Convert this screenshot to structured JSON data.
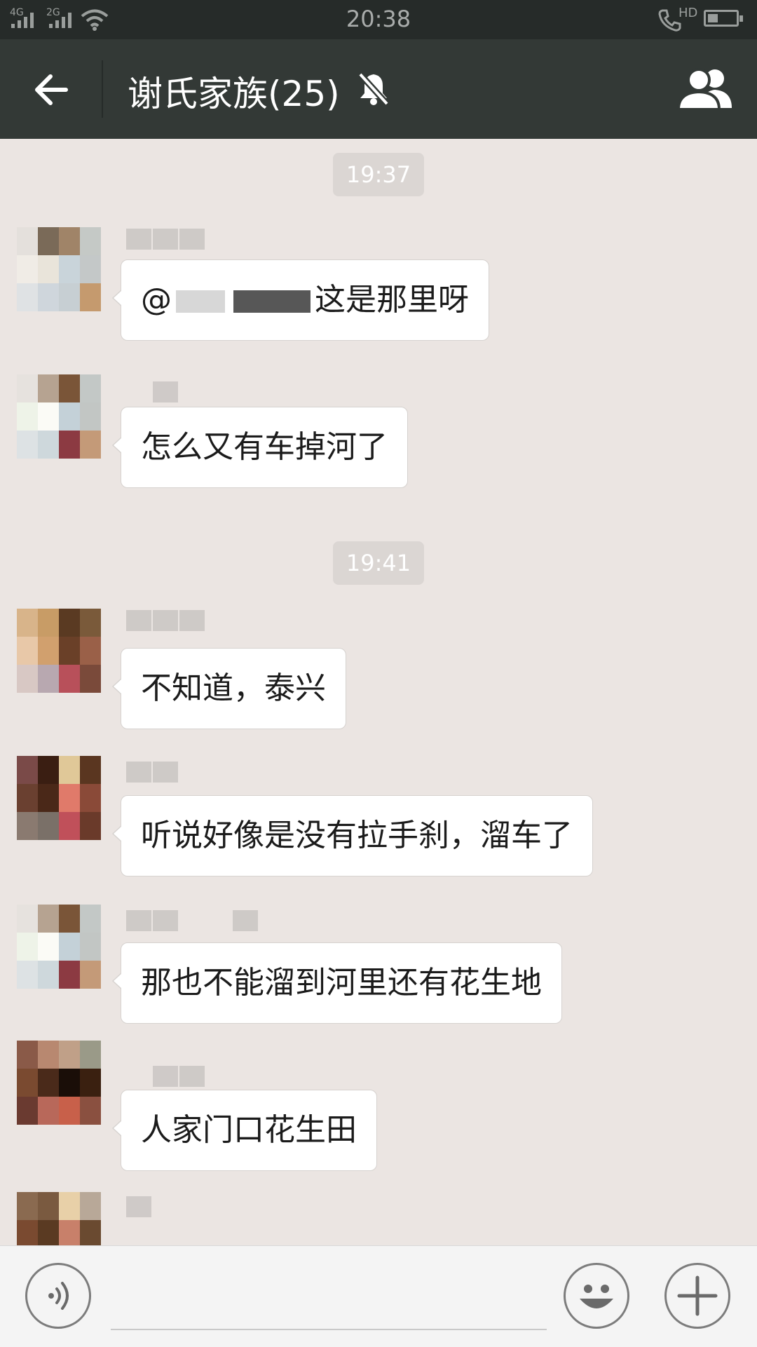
{
  "status_bar": {
    "time": "20:38",
    "network_1": "4G",
    "network_2": "2G",
    "hd_label": "HD",
    "icons": [
      "signal-icon",
      "signal-icon",
      "wifi-icon",
      "hd-call-icon",
      "battery-icon"
    ]
  },
  "header": {
    "back_icon": "back-arrow-icon",
    "title": "谢氏家族(25)",
    "mute_icon": "bell-muted-icon",
    "group_icon": "group-members-icon"
  },
  "timestamps": [
    "19:37",
    "19:41"
  ],
  "messages": [
    {
      "prefix": "@",
      "text": "这是那里呀"
    },
    {
      "text": "怎么又有车掉河了"
    },
    {
      "text": "不知道，泰兴"
    },
    {
      "text": "听说好像是没有拉手刹，溜车了"
    },
    {
      "text": "那也不能溜到河里还有花生地"
    },
    {
      "text": "人家门口花生田"
    }
  ],
  "input_bar": {
    "voice_icon": "voice-icon",
    "emoji_icon": "emoji-icon",
    "plus_icon": "plus-icon"
  },
  "colors": {
    "header_bg": "#333936",
    "status_bg": "#262b29",
    "chat_bg": "#ebe5e2",
    "bubble_bg": "#ffffff"
  }
}
